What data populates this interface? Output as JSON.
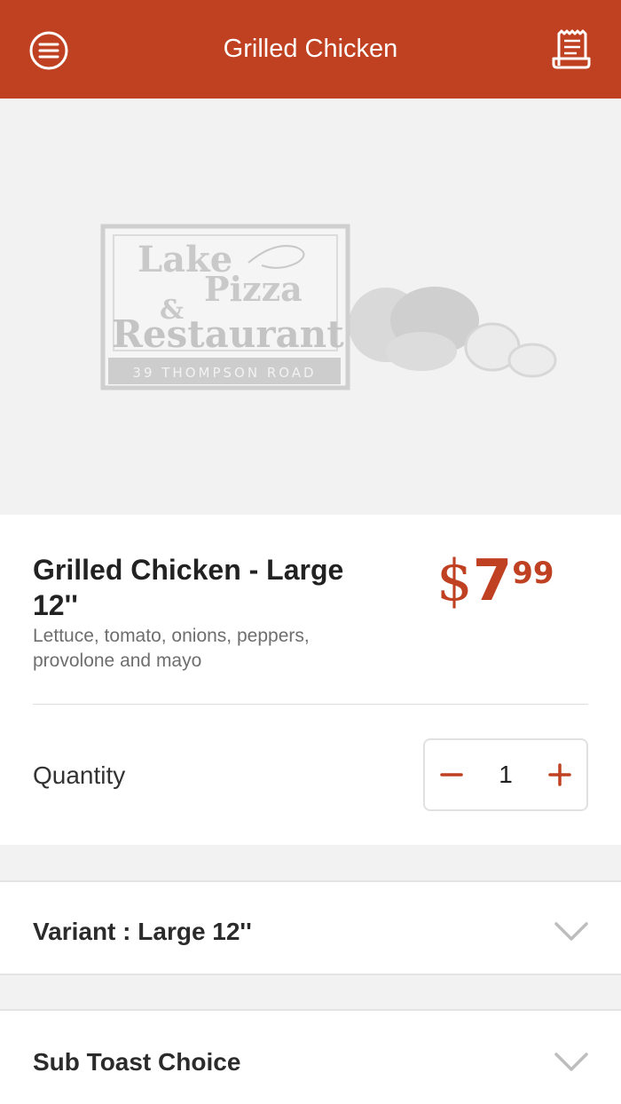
{
  "header": {
    "title": "Grilled Chicken",
    "menu_icon": "menu-icon",
    "receipt_icon": "receipt-icon",
    "color": "#c04122"
  },
  "hero": {
    "logo": {
      "line1": "Lake",
      "line2": "Pizza",
      "ampersand": "&",
      "line3": "Restaurant",
      "address": "39 THOMPSON ROAD"
    }
  },
  "item": {
    "name": "Grilled Chicken - Large 12''",
    "description": "Lettuce, tomato, onions, peppers, provolone and mayo",
    "price": {
      "symbol": "$",
      "dollars": "7",
      "cents": "99"
    }
  },
  "quantity": {
    "label": "Quantity",
    "value": "1",
    "minus_icon": "minus-icon",
    "plus_icon": "plus-icon"
  },
  "options": {
    "variant_label": "Variant : Large 12''",
    "toast_label": "Sub Toast Choice",
    "chevron_icon": "chevron-down-icon"
  },
  "colors": {
    "accent": "#c04122",
    "background": "#f2f2f2",
    "text": "#333333",
    "muted": "#6e6e6e"
  }
}
